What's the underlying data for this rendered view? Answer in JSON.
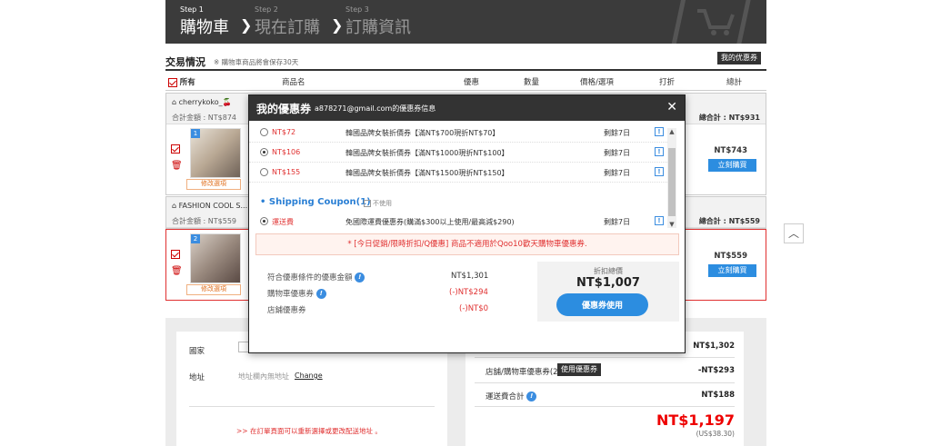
{
  "steps": [
    {
      "num": "Step 1",
      "name": "購物車"
    },
    {
      "num": "Step 2",
      "name": "現在訂購"
    },
    {
      "num": "Step 3",
      "name": "訂購資訊"
    }
  ],
  "section": {
    "title": "交易情況",
    "note": "※ 購物車商品將會保存30天",
    "my_coupon_btn": "我的优惠券"
  },
  "table_header": {
    "all": "所有",
    "product": "商品名",
    "benefit": "優惠",
    "qty": "數量",
    "price_opt": "價格/選項",
    "discount": "打折",
    "total": "總計"
  },
  "sellers": [
    {
      "name": "cherrykoko_🍒",
      "subtotal": "合計金額 : NT$874",
      "total": "總合計 : NT$931",
      "item_badge": "1",
      "edit": "修改選項",
      "price": "NT$743",
      "buy": "立刻購買"
    },
    {
      "name": "FASHION COOL S...",
      "subtotal": "合計金額 : NT$559",
      "total": "總合計 : NT$559",
      "item_badge": "2",
      "edit": "修改選項",
      "price": "NT$559",
      "buy": "立刻購買"
    }
  ],
  "address": {
    "country_label": "國家",
    "address_label": "地址",
    "placeholder": "地址欄內無地址",
    "change": "Change",
    "notice": ">> 在訂單頁面可以重新選擇或更改配送地址 。"
  },
  "summary": {
    "row1_val": "NT$1,302",
    "row2_label": "店舖/購物車優惠券(2)",
    "row2_btn": "使用優惠券",
    "row2_val": "-NT$293",
    "row3_label": "運送費合計",
    "row3_val": "NT$188",
    "grand_total": "NT$1,197",
    "usd": "(US$38.30)"
  },
  "modal": {
    "title": "我的優惠券",
    "email": "a878271@gmail.com的優惠券信息",
    "coupons": [
      {
        "name": "NT$72",
        "desc": "韓國品牌女裝折價券【滿NT$700現折NT$70】",
        "days": "剩餘7日"
      },
      {
        "name": "NT$106",
        "desc": "韓國品牌女裝折價券【滿NT$1000現折NT$100】",
        "days": "剩餘7日"
      },
      {
        "name": "NT$155",
        "desc": "韓國品牌女裝折價券【滿NT$1500現折NT$150】",
        "days": "剩餘7日"
      }
    ],
    "shipping_title": "Shipping Coupon(1)",
    "shipping_nouse": "不使用",
    "shipping": {
      "name": "運送費",
      "desc": "免國際運費優惠券(購滿$300以上使用/最高減$290)",
      "days": "剩餘7日"
    },
    "notice": "* [今日促銷/限時折扣/Q優惠] 商品不適用於Qoo10歡天購物車優惠券.",
    "sum_rows": [
      {
        "label": "符合優惠條件的優惠金額",
        "val": "NT$1,301"
      },
      {
        "label": "購物車優惠券",
        "val": "(-)NT$294"
      },
      {
        "label": "店鋪優惠券",
        "val": "(-)NT$0"
      }
    ],
    "discount_title": "折扣總價",
    "discount_value": "NT$1,007",
    "apply_btn": "優惠券使用",
    "info_glyph": "!",
    "close_glyph": "✕"
  },
  "scroll_top_glyph": "︿",
  "colors": {
    "accent_blue": "#2c8de0",
    "red": "#e03030",
    "dark": "#333333"
  }
}
